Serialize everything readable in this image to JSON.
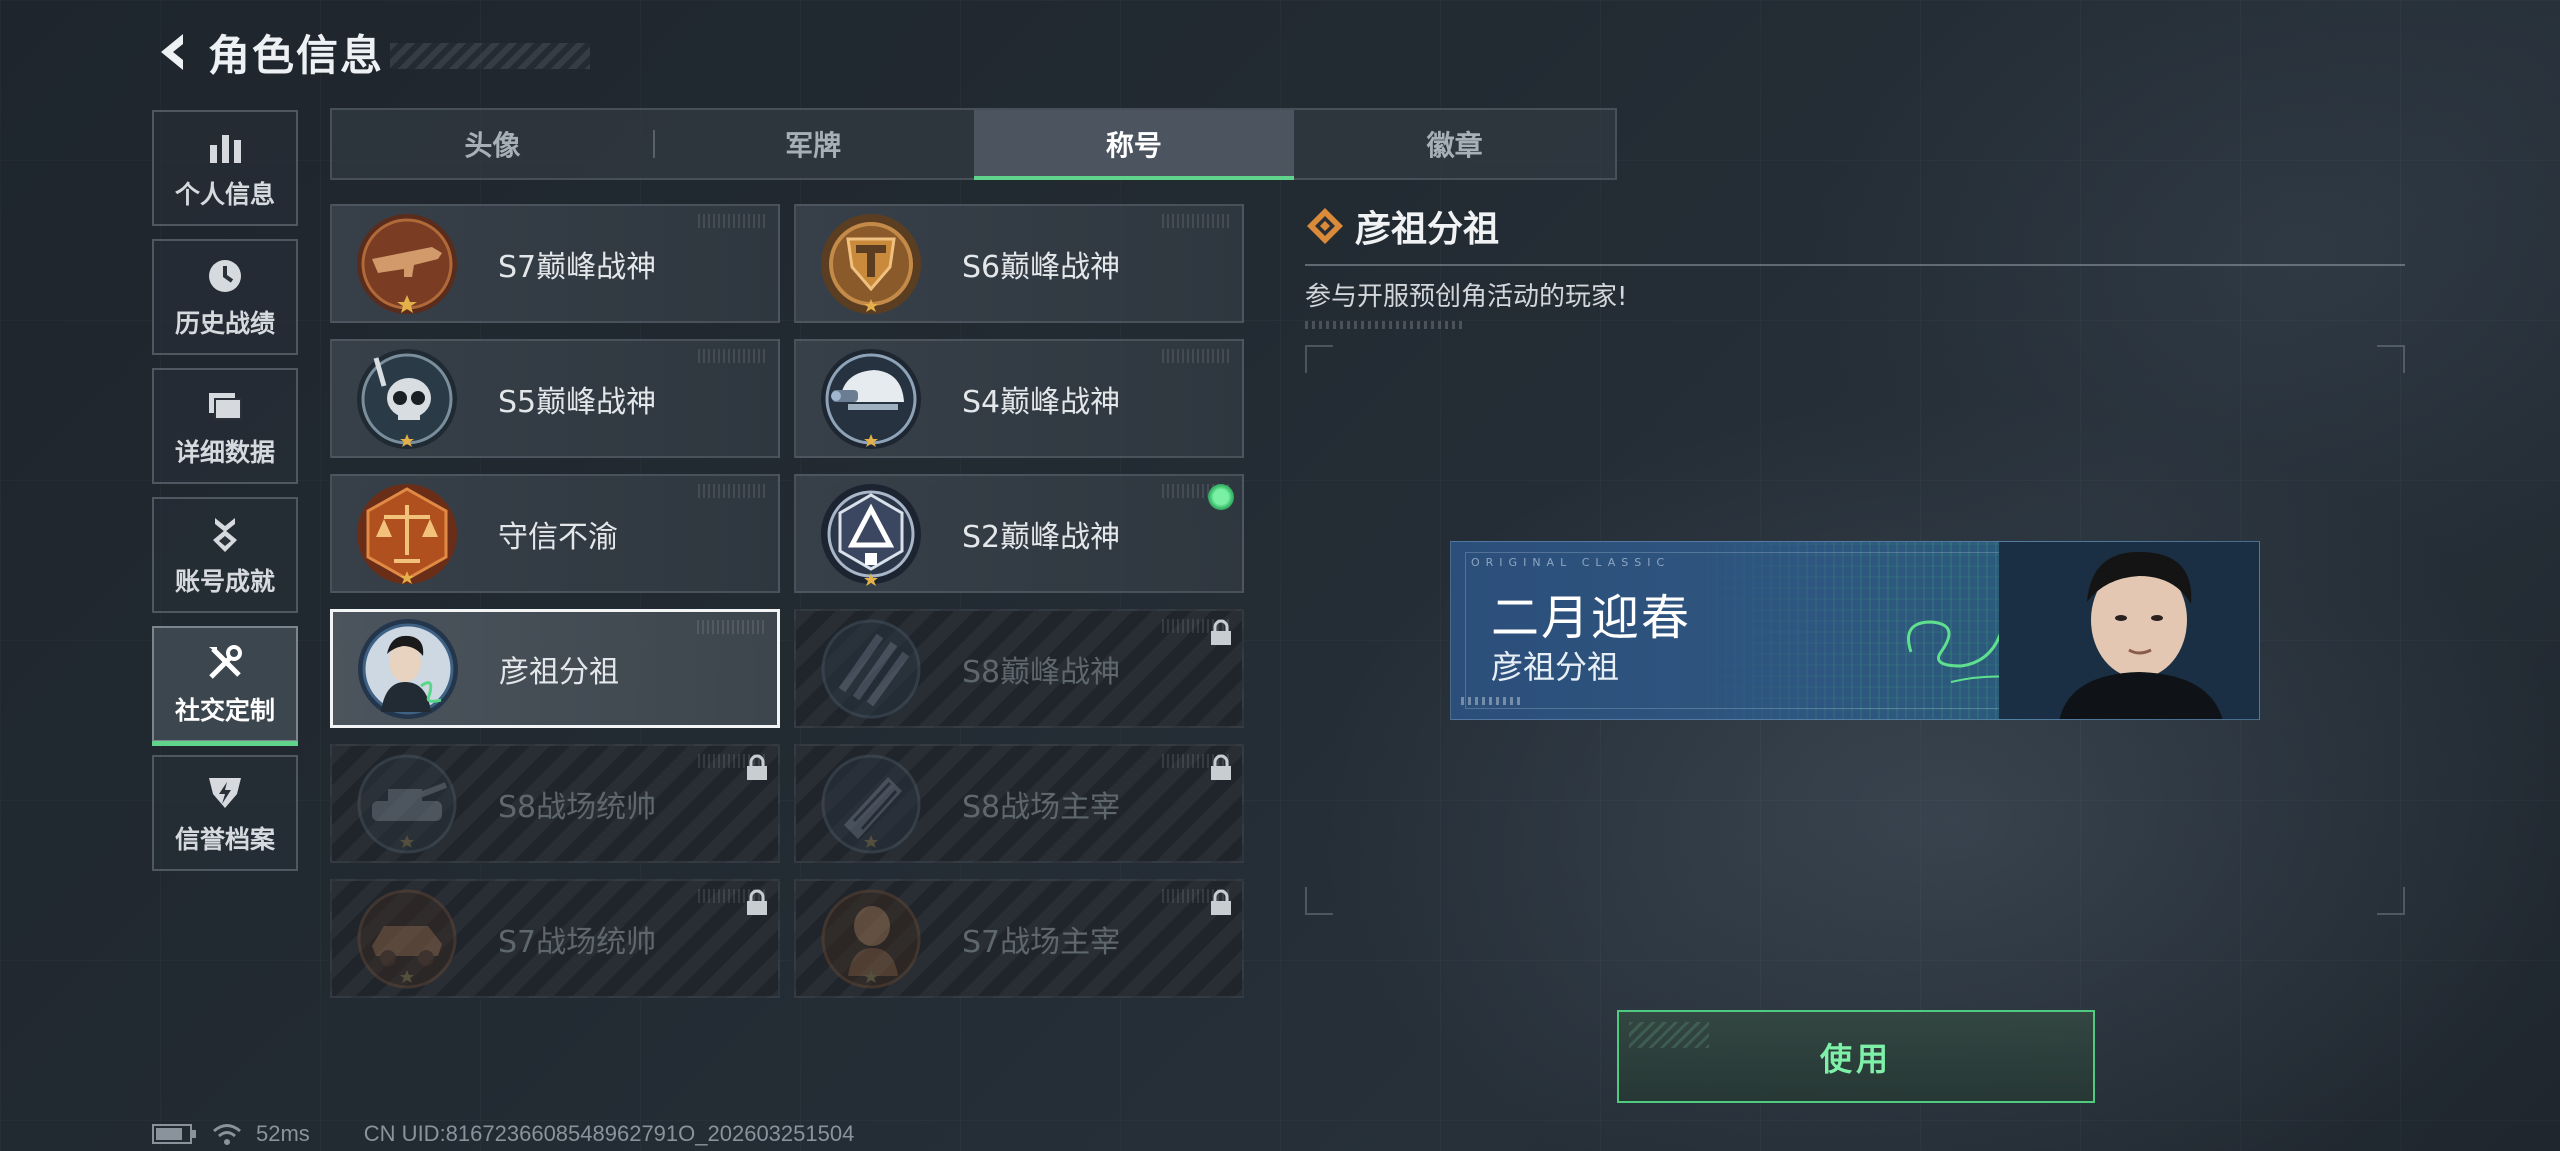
{
  "header": {
    "title": "角色信息"
  },
  "side_nav": [
    {
      "label": "个人信息",
      "icon": "bar-chart-icon"
    },
    {
      "label": "历史战绩",
      "icon": "clock-icon"
    },
    {
      "label": "详细数据",
      "icon": "folder-icon"
    },
    {
      "label": "账号成就",
      "icon": "medal-icon"
    },
    {
      "label": "社交定制",
      "icon": "tools-icon",
      "active": true
    },
    {
      "label": "信誉档案",
      "icon": "shield-icon"
    }
  ],
  "tabs": [
    {
      "label": "头像"
    },
    {
      "label": "军牌"
    },
    {
      "label": "称号",
      "active": true
    },
    {
      "label": "徽章"
    }
  ],
  "titles": [
    {
      "label": "S7巅峰战神",
      "locked": false,
      "icon": "rifle-emblem-icon"
    },
    {
      "label": "S6巅峰战神",
      "locked": false,
      "icon": "shield-t-emblem-icon"
    },
    {
      "label": "S5巅峰战神",
      "locked": false,
      "icon": "skull-emblem-icon"
    },
    {
      "label": "S4巅峰战神",
      "locked": false,
      "icon": "helmet-emblem-icon"
    },
    {
      "label": "守信不渝",
      "locked": false,
      "icon": "scales-emblem-icon"
    },
    {
      "label": "S2巅峰战神",
      "locked": false,
      "equipped": true,
      "icon": "triangle-emblem-icon"
    },
    {
      "label": "彦祖分祖",
      "locked": false,
      "selected": true,
      "icon": "portrait-emblem-icon"
    },
    {
      "label": "S8巅峰战神",
      "locked": true,
      "icon": "stripes-emblem-icon"
    },
    {
      "label": "S8战场统帅",
      "locked": true,
      "icon": "tank-emblem-icon"
    },
    {
      "label": "S8战场主宰",
      "locked": true,
      "icon": "building-emblem-icon"
    },
    {
      "label": "S7战场统帅",
      "locked": true,
      "icon": "vehicle-emblem-icon"
    },
    {
      "label": "S7战场主宰",
      "locked": true,
      "icon": "soldier-emblem-icon"
    }
  ],
  "detail": {
    "title": "彦祖分祖",
    "description": "参与开服预创角活动的玩家!",
    "banner": {
      "small_text": "ORIGINAL CLASSIC",
      "main_text": "二月迎春",
      "sub_text": "彦祖分祖"
    },
    "use_button": "使用"
  },
  "status": {
    "ping": "52ms",
    "uid": "CN UID:8167236608548962791O_202603251504"
  },
  "colors": {
    "accent_green": "#5fd48a",
    "banner_blue": "#2f5680",
    "medal_bronze": "#b06a3a"
  }
}
